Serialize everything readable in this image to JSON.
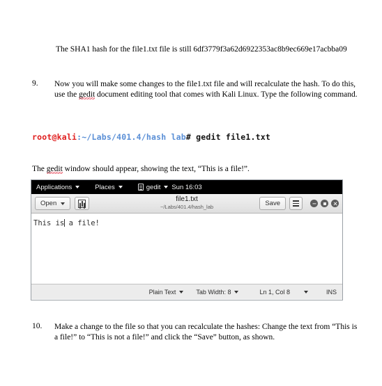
{
  "document": {
    "sha_line": "The SHA1 hash for the file1.txt file is still 6df3779f3a62d6922353ac8b9ec669e17acbba09",
    "item9": {
      "number": "9.",
      "text_before_gedit": "Now you will make some changes to the file1.txt file and will recalculate the hash. To do this, use the ",
      "gedit_word": "gedit",
      "text_after_gedit": " document editing tool that comes with Kali Linux. Type the following command."
    },
    "caption": {
      "before": "The ",
      "gedit_word": "gedit",
      "after": " window should appear, showing the text, “This is a file!”."
    },
    "item10": {
      "number": "10.",
      "text": "Make a change to the file so that you can recalculate the hashes: Change the text from “This is a file!” to “This is not a file!” and click the “Save” button, as shown."
    }
  },
  "terminal": {
    "user_host": "root@kali",
    "path": ":~/Labs/401.4/hash lab",
    "command": "# gedit file1.txt",
    "color_user": "#e02020",
    "color_path": "#5a8fd6",
    "color_command": "#111111"
  },
  "gnome_panel": {
    "applications": "Applications",
    "places": "Places",
    "app_name": "gedit",
    "clock": "Sun 16:03",
    "background": "#000000",
    "foreground": "#f2f2f2"
  },
  "gedit": {
    "open_button": "Open",
    "new_document_icon": "new-document-icon",
    "title": "file1.txt",
    "subtitle": "~/Labs/401.4/hash_lab",
    "save_button": "Save",
    "menu_icon": "hamburger-menu-icon",
    "window_controls": {
      "minimize": "minimize-icon",
      "maximize": "maximize-icon",
      "close": "close-icon"
    },
    "editor": {
      "text_before_cursor": "This is",
      "text_after_cursor": " a file!"
    },
    "statusbar": {
      "language": "Plain Text",
      "tab_width": "Tab Width: 8",
      "position": "Ln 1, Col 8",
      "insert_mode": "INS"
    }
  }
}
